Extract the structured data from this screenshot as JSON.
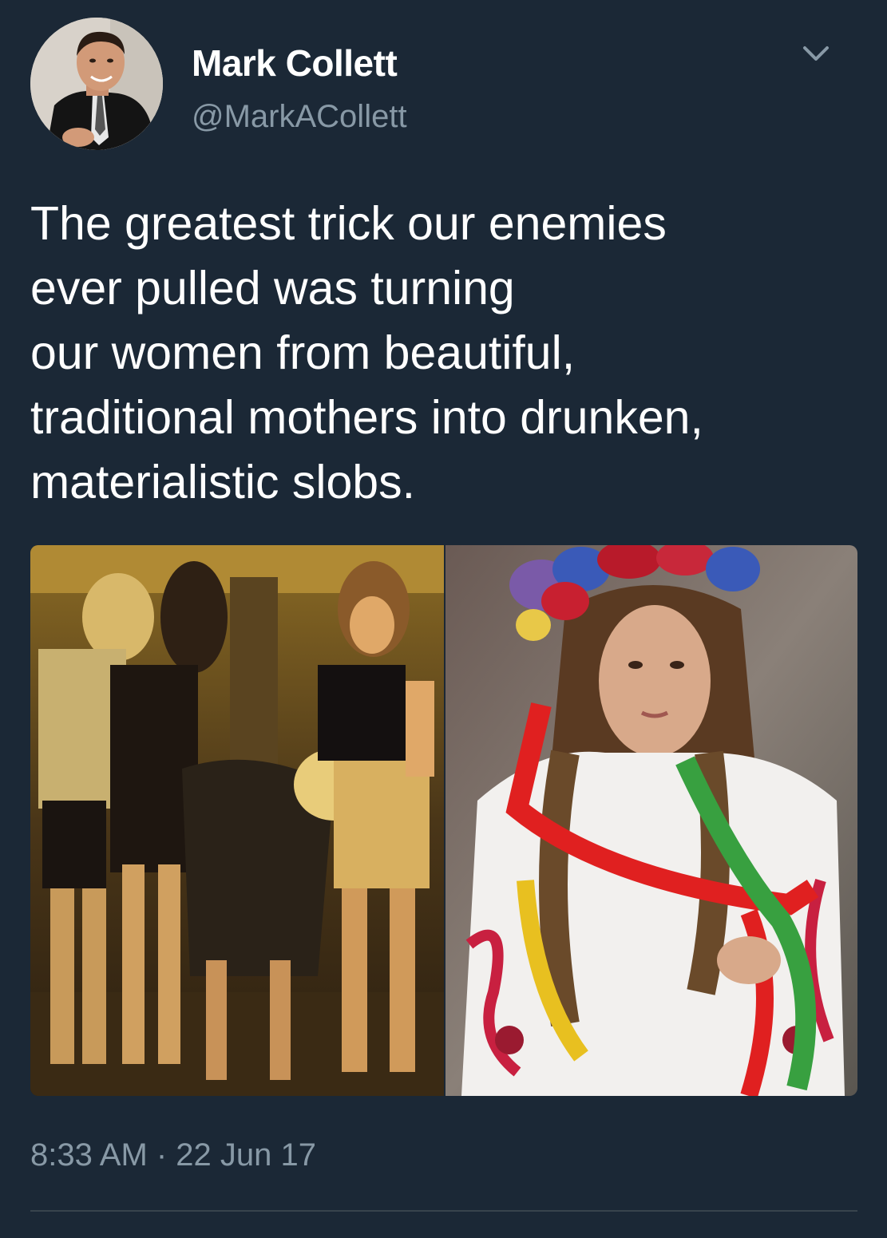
{
  "tweet": {
    "author": {
      "display_name": "Mark Collett",
      "handle": "@MarkACollett"
    },
    "text": "The greatest trick our enemies\never pulled was turning\nour women from beautiful,\ntraditional mothers into drunken,\nmaterialistic slobs.",
    "timestamp": "8:33 AM · 22 Jun 17",
    "menu_icon": "chevron-down-icon",
    "colors": {
      "background": "#1b2836",
      "primary_text": "#ffffff",
      "secondary_text": "#8899a6"
    }
  }
}
